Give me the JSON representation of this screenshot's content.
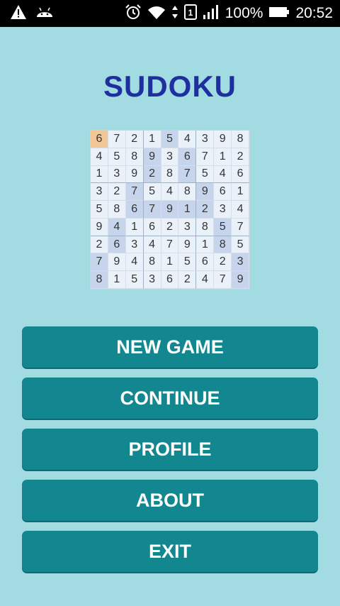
{
  "status_bar": {
    "battery": "100%",
    "time": "20:52",
    "icons": [
      "warning-icon",
      "android-icon",
      "alarm-icon",
      "wifi-icon",
      "data-arrows-icon",
      "sim-icon",
      "signal-icon",
      "battery-icon"
    ]
  },
  "app": {
    "title": "SUDOKU"
  },
  "board": {
    "grid": [
      [
        6,
        7,
        2,
        1,
        5,
        4,
        3,
        9,
        8
      ],
      [
        4,
        5,
        8,
        9,
        3,
        6,
        7,
        1,
        2
      ],
      [
        1,
        3,
        9,
        2,
        8,
        7,
        5,
        4,
        6
      ],
      [
        3,
        2,
        7,
        5,
        4,
        8,
        9,
        6,
        1
      ],
      [
        5,
        8,
        6,
        7,
        9,
        1,
        2,
        3,
        4
      ],
      [
        9,
        4,
        1,
        6,
        2,
        3,
        8,
        5,
        7
      ],
      [
        2,
        6,
        3,
        4,
        7,
        9,
        1,
        8,
        5
      ],
      [
        7,
        9,
        4,
        8,
        1,
        5,
        6,
        2,
        3
      ],
      [
        8,
        1,
        5,
        3,
        6,
        2,
        4,
        7,
        9
      ]
    ],
    "selected": [
      0,
      0
    ],
    "given": [
      [
        0,
        4
      ],
      [
        1,
        3
      ],
      [
        1,
        5
      ],
      [
        2,
        3
      ],
      [
        2,
        5
      ],
      [
        3,
        2
      ],
      [
        3,
        6
      ],
      [
        4,
        2
      ],
      [
        4,
        3
      ],
      [
        4,
        4
      ],
      [
        4,
        5
      ],
      [
        4,
        6
      ],
      [
        5,
        1
      ],
      [
        5,
        7
      ],
      [
        6,
        1
      ],
      [
        6,
        7
      ],
      [
        7,
        0
      ],
      [
        7,
        8
      ],
      [
        8,
        0
      ],
      [
        8,
        8
      ]
    ]
  },
  "menu": {
    "new_game": "NEW GAME",
    "continue": "CONTINUE",
    "profile": "PROFILE",
    "about": "ABOUT",
    "exit": "EXIT"
  },
  "colors": {
    "background": "#a3dbe3",
    "title": "#1e2f9e",
    "button": "#12878f",
    "given_cell": "#c7d5ec",
    "selected_cell": "#f3c896"
  }
}
